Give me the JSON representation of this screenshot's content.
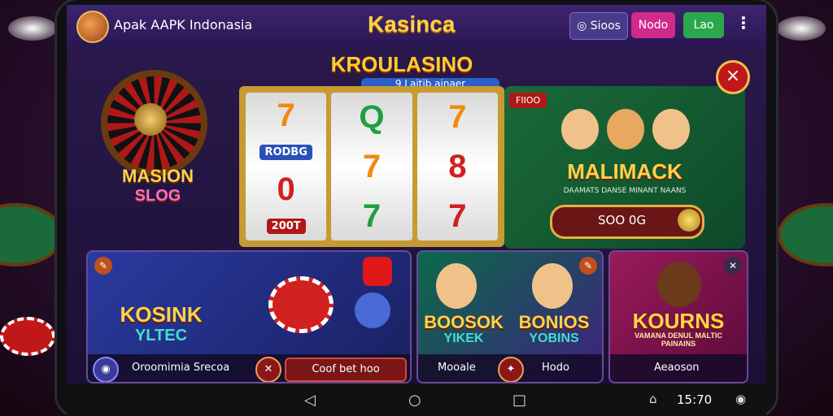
{
  "header": {
    "app_name": "Apak AAPK Indonasia",
    "center_title": "Kasinca",
    "coins_label": "Sioos",
    "mode_label": "Nodo",
    "login_label": "Lao"
  },
  "hero": {
    "roulette_label": "MASION",
    "roulette_sub": "SLOG",
    "slot_title": "KROULASINO",
    "slot_subtitle": "9 Laitib ainaer",
    "reels": [
      {
        "symbols": [
          "7",
          "RODBG",
          "0",
          "200T"
        ]
      },
      {
        "symbols": [
          "Q",
          "7",
          "7"
        ]
      },
      {
        "symbols": [
          "7",
          "8",
          "7"
        ]
      }
    ],
    "promo_tag": "FIIOO",
    "promo_name": "MALIMACK",
    "promo_small_text": "DAAMATS DANSE MINANT NAANS",
    "promo_value": "SOO 0G",
    "close_label": "×"
  },
  "cards": [
    {
      "title": "KOSINK",
      "subtitle": "YLTEC",
      "footer_text": "Oroomimia Srecoa",
      "pill_label": "Coof bet hoo"
    },
    {
      "title_left": "BOOSOK",
      "sub_left": "YIKEK",
      "title_right": "BONIOS",
      "sub_right": "YOBINS",
      "footer_left": "Mooale",
      "footer_right": "Hodo"
    },
    {
      "title": "KOURNS",
      "subtitle": "VAMANA DENUL MALTIC PAINAINS",
      "footer_text": "Aeaoson"
    }
  ],
  "navbar": {
    "back": "◁",
    "home": "○",
    "recents": "□",
    "time": "15:70"
  }
}
